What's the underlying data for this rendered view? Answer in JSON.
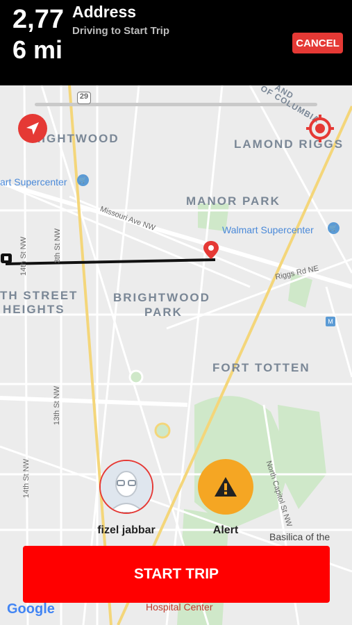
{
  "header": {
    "distance_value": "2,77",
    "distance_unit": "6 mi",
    "title": "Address",
    "subtitle": "Driving to Start Trip",
    "cancel_label": "CANCEL"
  },
  "map": {
    "neighborhoods": {
      "brightwood_top": "RIGHTWOOD",
      "lamond_riggs": "LAMOND RIGGS",
      "manor_park": "MANOR PARK",
      "brightwood_park_1": "BRIGHTWOOD",
      "brightwood_park_2": "PARK",
      "sixteenth_heights_1": "TH STREET",
      "sixteenth_heights_2": "HEIGHTS",
      "fort_totten": "FORT TOTTEN",
      "district_1": "AND",
      "district_2": "OF COLUMBIA"
    },
    "pois": {
      "supercenter_left": "art Supercenter",
      "walmart": "Walmart Supercenter",
      "basilica": "Basilica of the",
      "hospital": "Hospital Center"
    },
    "streets": {
      "missouri": "Missouri Ave NW",
      "riggs": "Riggs Rd NE",
      "fourteenth_a": "14th St NW",
      "thirteenth_a": "3th St NW",
      "thirteenth_b": "13th St NW",
      "fourteenth_b": "14th St NW",
      "north_capitol": "North Capitol St NW",
      "route": "29"
    },
    "attribution": "Google"
  },
  "actions": {
    "profile_name": "fizel jabbar",
    "alert_label": "Alert",
    "start_label": "START TRIP"
  },
  "colors": {
    "accent": "#e53935",
    "alert": "#f5a623",
    "start": "#ff0000"
  }
}
